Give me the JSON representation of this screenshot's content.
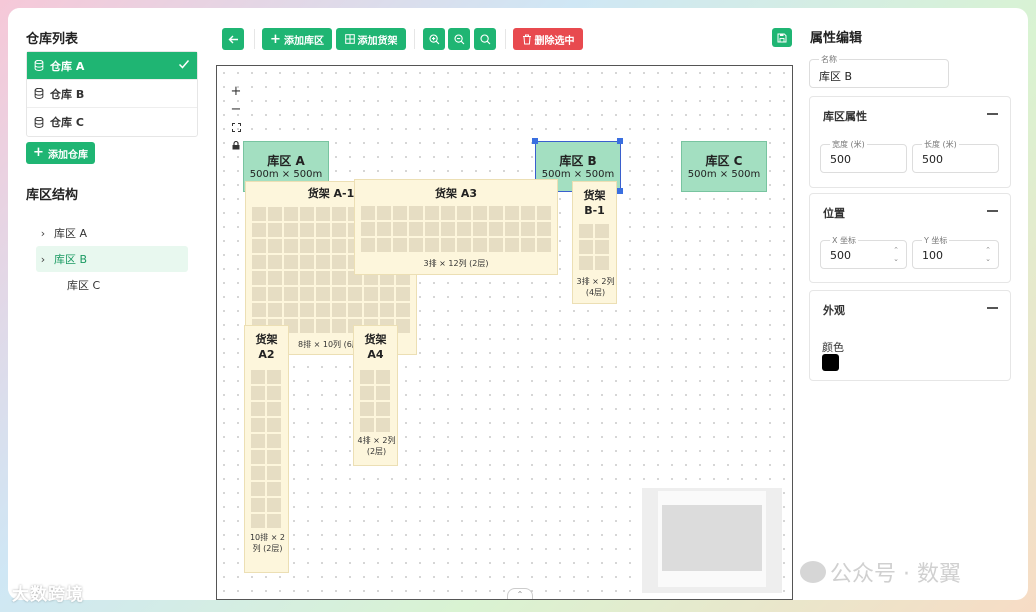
{
  "sidebar": {
    "warehouse_list_title": "仓库列表",
    "warehouses": [
      {
        "label": "仓库 A",
        "active": true
      },
      {
        "label": "仓库 B",
        "active": false
      },
      {
        "label": "仓库 C",
        "active": false
      }
    ],
    "add_warehouse": "添加仓库",
    "zone_structure_title": "库区结构",
    "tree": [
      {
        "label": "库区 A"
      },
      {
        "label": "库区 B"
      },
      {
        "label": "库区 C"
      }
    ]
  },
  "toolbar": {
    "add_zone": "添加库区",
    "add_shelf": "添加货架",
    "delete_selected": "删除选中"
  },
  "canvas": {
    "zones": [
      {
        "title": "库区 A",
        "size": "500m × 500m"
      },
      {
        "title": "库区 B",
        "size": "500m × 500m"
      },
      {
        "title": "库区 C",
        "size": "500m × 500m"
      }
    ],
    "shelves": {
      "a1": {
        "title": "货架 A-1",
        "dims": "8排 × 10列 (6层)"
      },
      "a3": {
        "title": "货架 A3",
        "dims": "3排 × 12列 (2层)"
      },
      "b1": {
        "title": "货架 B-1",
        "dims": "3排 × 2列 (4层)"
      },
      "a2": {
        "title": "货架 A2",
        "dims": "10排 × 2列 (2层)"
      },
      "a4": {
        "title": "货架 A4",
        "dims": "4排 × 2列 (2层)"
      }
    }
  },
  "properties": {
    "title": "属性编辑",
    "name_label": "名称",
    "name_value": "库区 B",
    "zone_props_title": "库区属性",
    "width_label": "宽度 (米)",
    "width_value": "500",
    "length_label": "长度 (米)",
    "length_value": "500",
    "position_title": "位置",
    "x_label": "X 坐标",
    "x_value": "500",
    "y_label": "Y 坐标",
    "y_value": "100",
    "appearance_title": "外观",
    "color_label": "颜色",
    "color_value": "#000000"
  },
  "watermarks": {
    "left": "大数跨境",
    "right": "公众号 · 数翼"
  },
  "colors": {
    "accent": "#1fb573",
    "danger": "#e84a4f",
    "zone": "#a3dfc1",
    "shelf": "#fdf6dc",
    "selection": "#3a5fcd"
  }
}
